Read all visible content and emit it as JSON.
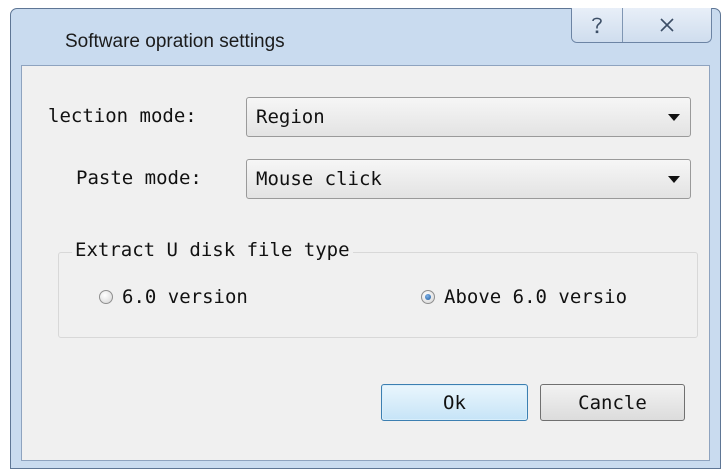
{
  "window": {
    "title": "Software opration settings"
  },
  "caption": {
    "help_icon": "help-question-icon",
    "close_icon": "close-x-icon"
  },
  "selection_mode": {
    "label": "lection mode:",
    "value": "Region"
  },
  "paste_mode": {
    "label": "Paste mode:",
    "value": "Mouse click"
  },
  "file_type_group": {
    "title": "Extract U disk file type",
    "options": [
      {
        "label": "6.0 version",
        "checked": false
      },
      {
        "label": "Above 6.0 versio",
        "checked": true
      }
    ]
  },
  "buttons": {
    "ok": "Ok",
    "cancel": "Cancle"
  },
  "colors": {
    "frame": "#c9dbef",
    "client": "#f0f0f0",
    "default_button_border": "#3c7fb1"
  }
}
